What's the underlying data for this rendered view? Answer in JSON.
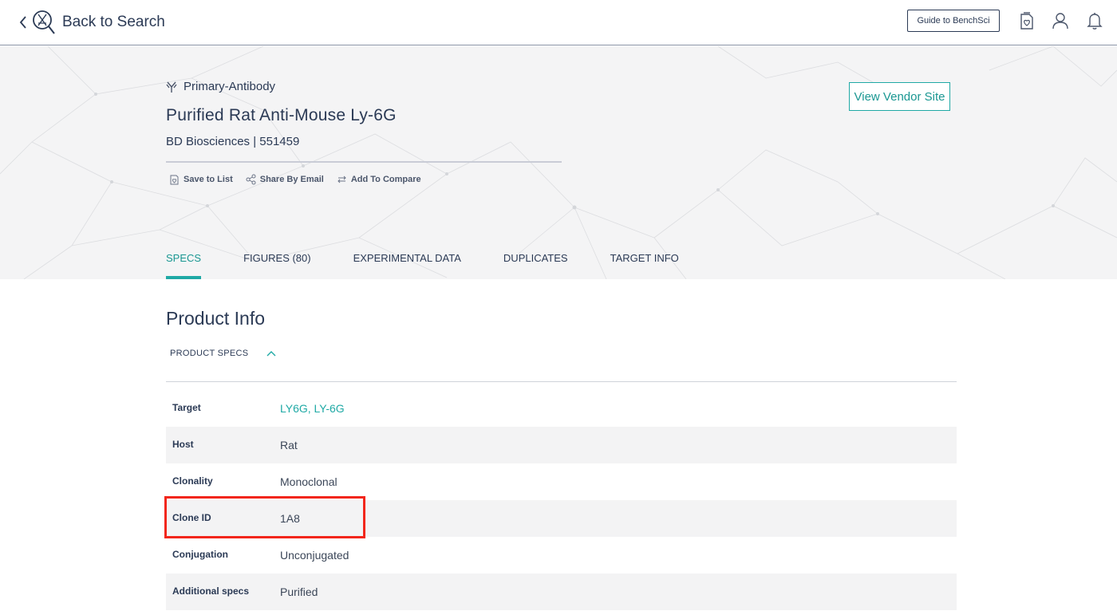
{
  "topbar": {
    "back_label": "Back to Search",
    "guide_button": "Guide to BenchSci",
    "icons": [
      "saved-list-icon",
      "user-icon",
      "bell-icon"
    ]
  },
  "product": {
    "type": "Primary-Antibody",
    "title": "Purified Rat Anti-Mouse Ly-6G",
    "vendor_line": "BD Biosciences | 551459",
    "vendor_button": "View Vendor Site",
    "actions": [
      {
        "label": "Save to List",
        "icon": "save-list-icon"
      },
      {
        "label": "Share By Email",
        "icon": "share-icon"
      },
      {
        "label": "Add To Compare",
        "icon": "compare-icon"
      }
    ]
  },
  "tabs": [
    {
      "label": "SPECS",
      "active": true
    },
    {
      "label": "FIGURES (80)",
      "active": false
    },
    {
      "label": "EXPERIMENTAL DATA",
      "active": false
    },
    {
      "label": "DUPLICATES",
      "active": false
    },
    {
      "label": "TARGET INFO",
      "active": false
    }
  ],
  "product_info": {
    "heading": "Product Info",
    "toggle_label": "PRODUCT SPECS",
    "specs": [
      {
        "key": "Target",
        "value": "LY6G, LY-6G",
        "link": true
      },
      {
        "key": "Host",
        "value": "Rat",
        "link": false
      },
      {
        "key": "Clonality",
        "value": "Monoclonal",
        "link": false
      },
      {
        "key": "Clone ID",
        "value": "1A8",
        "link": false
      },
      {
        "key": "Conjugation",
        "value": "Unconjugated",
        "link": false
      },
      {
        "key": "Additional specs",
        "value": "Purified",
        "link": false
      }
    ]
  },
  "colors": {
    "accent": "#1fa9a5",
    "text": "#2b3a55",
    "highlight": "#f2261b",
    "row_alt": "#f3f3f4"
  }
}
